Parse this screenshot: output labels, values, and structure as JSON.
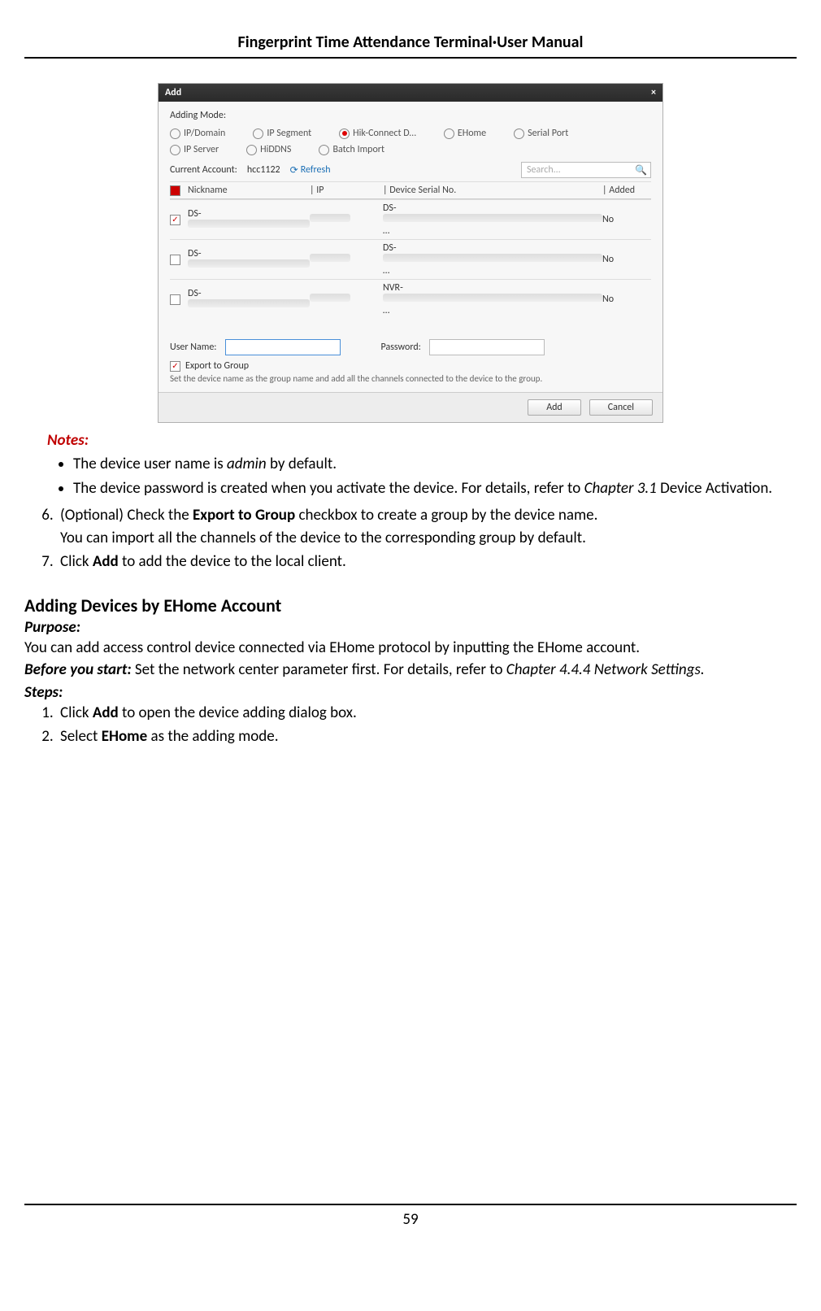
{
  "header": "Fingerprint Time Attendance Terminal·User Manual",
  "page_number": "59",
  "dialog": {
    "title": "Add",
    "adding_mode_label": "Adding Mode:",
    "radios_row1": [
      {
        "label": "IP/Domain",
        "checked": false
      },
      {
        "label": "IP Segment",
        "checked": false
      },
      {
        "label": "Hik-Connect D…",
        "checked": true
      },
      {
        "label": "EHome",
        "checked": false
      },
      {
        "label": "Serial Port",
        "checked": false
      }
    ],
    "radios_row2": [
      {
        "label": "IP Server",
        "checked": false
      },
      {
        "label": "HiDDNS",
        "checked": false
      },
      {
        "label": "Batch Import",
        "checked": false
      }
    ],
    "current_account_label": "Current Account:",
    "current_account_value": "hcc1122",
    "refresh_label": "Refresh",
    "search_placeholder": "Search...",
    "columns": {
      "nickname": "Nickname",
      "ip": "IP",
      "serial": "Device Serial No.",
      "added": "Added"
    },
    "rows": [
      {
        "checked": true,
        "nick_prefix": "DS-",
        "serial_prefix": "DS-",
        "added": "No"
      },
      {
        "checked": false,
        "nick_prefix": "DS-",
        "serial_prefix": "DS-",
        "added": "No"
      },
      {
        "checked": false,
        "nick_prefix": "DS-",
        "serial_prefix": "NVR-",
        "added": "No"
      }
    ],
    "username_label": "User Name:",
    "password_label": "Password:",
    "export_label": "Export to Group",
    "export_note": "Set the device name as the group name and add all the channels connected to the device to the group.",
    "add_btn": "Add",
    "cancel_btn": "Cancel"
  },
  "notes_label": "Notes:",
  "notes": [
    "The device user name is <em>admin</em> by default.",
    "The device password is created when you activate the device. For details, refer to <em>Chapter 3.1</em> Device Activation."
  ],
  "steps_a": [
    "(Optional) Check the <b>Export to Group</b> checkbox to create a group by the device name.<br>You can import all the channels of the device to the corresponding group by default.",
    "Click <b>Add</b> to add the device to the local client."
  ],
  "section_heading": "Adding Devices by EHome Account",
  "purpose_label": "Purpose:",
  "purpose_text": "You can add access control device connected via EHome protocol by inputting the EHome account.",
  "before_text": "<b><em>Before you start:</em></b> Set the network center parameter first. For details, refer to <em>Chapter 4.4.4 Network Settings.</em>",
  "steps_label": "Steps:",
  "steps_b": [
    "Click <b>Add</b> to open the device adding dialog box.",
    "Select <b>EHome</b> as the adding mode."
  ]
}
